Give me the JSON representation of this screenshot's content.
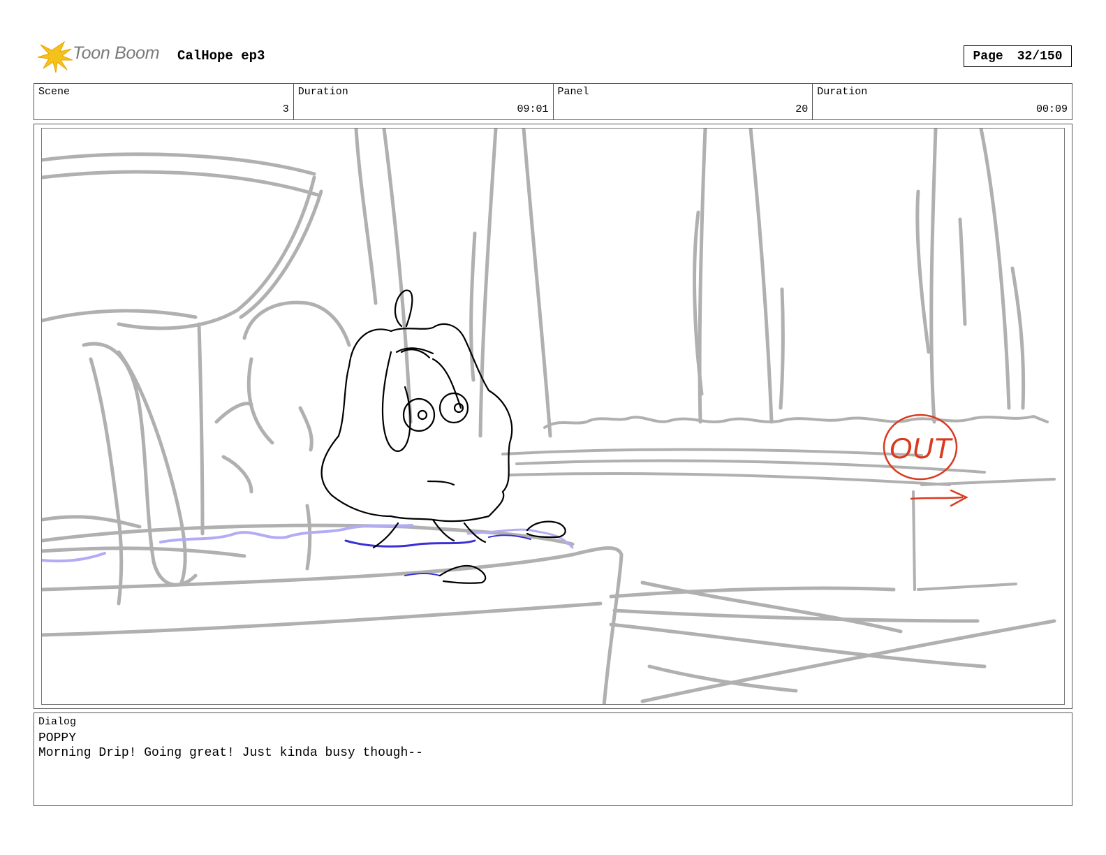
{
  "header": {
    "brand": "Toon Boom",
    "project_title": "CalHope ep3",
    "page_label": "Page",
    "page_value": "32/150"
  },
  "info": [
    {
      "label": "Scene",
      "value": "3"
    },
    {
      "label": "Duration",
      "value": "09:01"
    },
    {
      "label": "Panel",
      "value": "20"
    },
    {
      "label": "Duration",
      "value": "00:09"
    }
  ],
  "panel": {
    "out_sign_text": "OUT",
    "colors": {
      "sketch_gray": "#b0b0b0",
      "character_line": "#000000",
      "water_blue": "#b3acf5",
      "water_dark": "#3a30d6",
      "out_red": "#d93a1f"
    }
  },
  "dialog": {
    "label": "Dialog",
    "speaker": "POPPY",
    "line": "Morning Drip! Going great! Just kinda busy though--"
  }
}
